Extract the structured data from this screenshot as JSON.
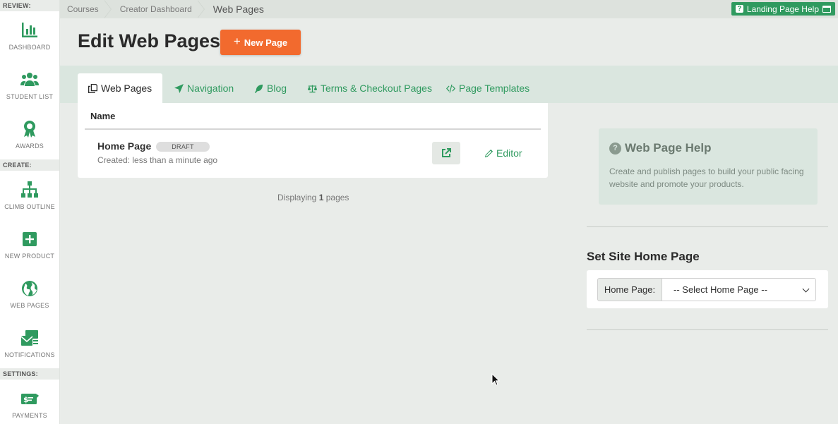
{
  "sidebar": {
    "sections": {
      "review": "REVIEW:",
      "create": "CREATE:",
      "settings": "SETTINGS:"
    },
    "items": [
      {
        "label": "DASHBOARD",
        "icon": "chart-icon"
      },
      {
        "label": "STUDENT LIST",
        "icon": "users-icon"
      },
      {
        "label": "AWARDS",
        "icon": "award-icon"
      },
      {
        "label": "CLIMB OUTLINE",
        "icon": "sitemap-icon"
      },
      {
        "label": "NEW PRODUCT",
        "icon": "plus-square-icon"
      },
      {
        "label": "WEB PAGES",
        "icon": "globe-icon"
      },
      {
        "label": "NOTIFICATIONS",
        "icon": "envelope-icon"
      },
      {
        "label": "PAYMENTS",
        "icon": "money-check-icon"
      }
    ]
  },
  "breadcrumbs": [
    "Courses",
    "Creator Dashboard",
    "Web Pages"
  ],
  "help_button": {
    "label": "Landing Page Help",
    "icon_q": "?"
  },
  "page": {
    "title": "Edit Web Pages",
    "new_page_label": "New Page",
    "new_page_plus": "+"
  },
  "tabs": [
    {
      "label": "Web Pages",
      "icon": "copy-icon",
      "active": true
    },
    {
      "label": "Navigation",
      "icon": "location-arrow-icon",
      "active": false
    },
    {
      "label": "Blog",
      "icon": "feather-icon",
      "active": false
    },
    {
      "label": "Terms & Checkout Pages",
      "icon": "balance-scale-icon",
      "active": false
    },
    {
      "label": "Page Templates",
      "icon": "code-icon",
      "active": false
    }
  ],
  "table": {
    "column_name": "Name",
    "rows": [
      {
        "title": "Home Page",
        "badge": "DRAFT",
        "created": "Created: less than a minute ago",
        "editor_label": "Editor"
      }
    ],
    "displaying_prefix": "Displaying",
    "displaying_count": "1",
    "displaying_suffix": "pages"
  },
  "help_card": {
    "title": "Web Page Help",
    "icon_q": "?",
    "body": "Create and publish pages to build your public facing website and promote your products."
  },
  "home_page": {
    "title": "Set Site Home Page",
    "label": "Home Page:",
    "selected": "-- Select Home Page --"
  },
  "colors": {
    "accent": "#2f9a5f",
    "new_page_button": "#f26a2e",
    "tab_band": "#dae6df",
    "background": "#e9ece9"
  }
}
